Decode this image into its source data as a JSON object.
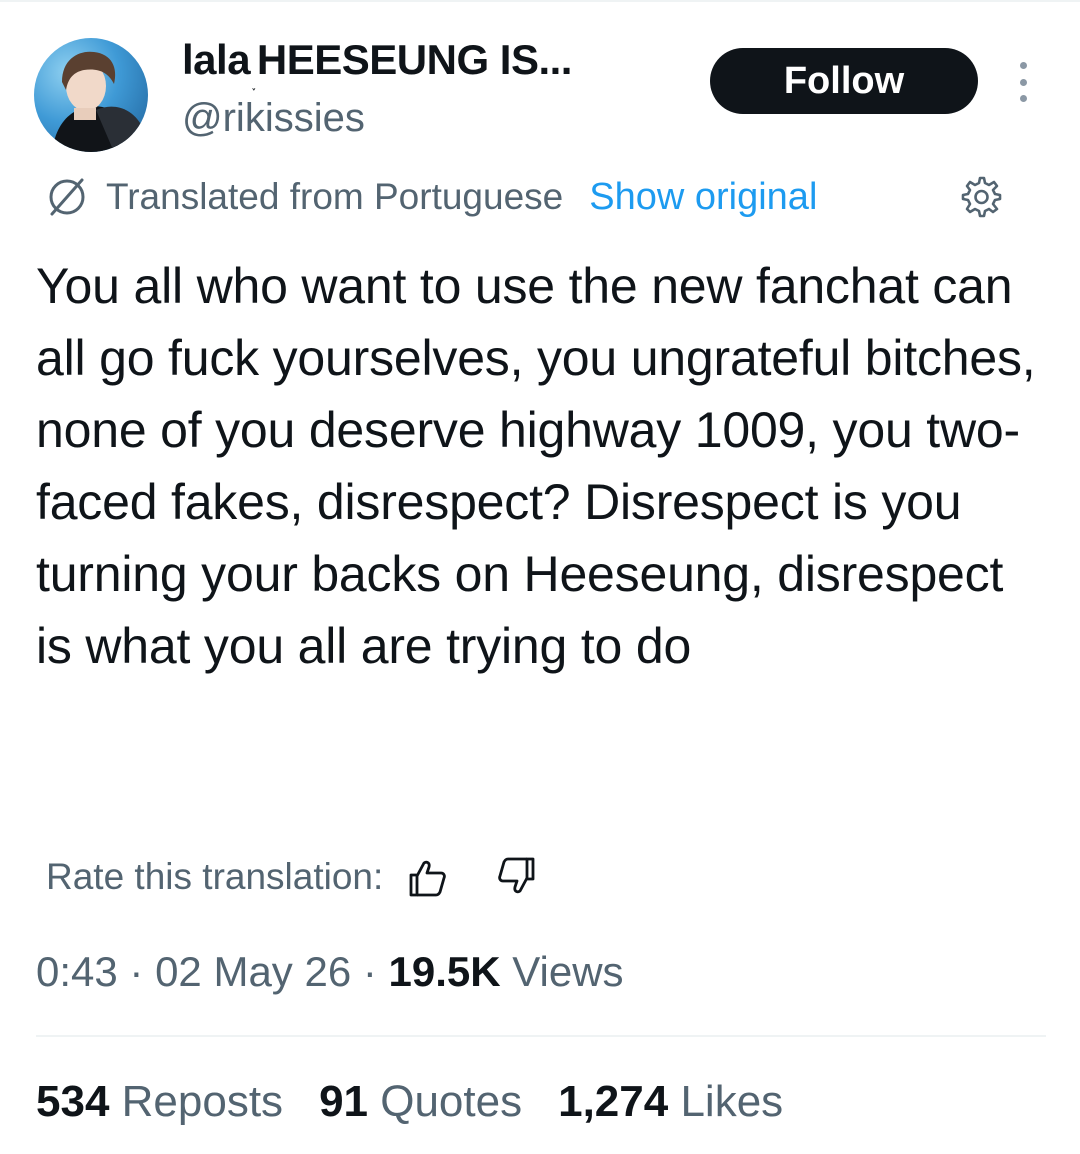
{
  "author": {
    "display_name": "lala",
    "display_name_deco": "˯",
    "display_name_rest": "HEESEUNG IS...",
    "handle": "@rikissies"
  },
  "follow_label": "Follow",
  "translation": {
    "label": "Translated from Portuguese",
    "show_original": "Show original",
    "rate_label": "Rate this translation:"
  },
  "tweet_text": "You all who want to use the new fanchat can all go fuck yourselves, you ungrateful bitches, none of you deserve highway 1009, you two-faced fakes, disrespect? Disrespect is you turning your backs on Heeseung, disrespect is what you all are trying to do",
  "meta": {
    "time": "0:43",
    "sep1": " · ",
    "date": "02 May 26",
    "sep2": " · ",
    "views_count": "19.5K",
    "views_label": " Views"
  },
  "stats": {
    "reposts_count": "534",
    "reposts_label": " Reposts",
    "quotes_count": "91",
    "quotes_label": " Quotes",
    "likes_count": "1,274",
    "likes_label": " Likes"
  },
  "icons": {
    "avatar": "profile-photo",
    "more": "more-vertical-icon",
    "translate": "globe-translate-icon",
    "settings": "gear-icon",
    "thumb_up": "thumb-up-icon",
    "thumb_down": "thumb-down-icon"
  },
  "colors": {
    "text_primary": "#0f1419",
    "text_secondary": "#536471",
    "link": "#1d9bf0",
    "button_bg": "#0f1419",
    "divider": "#eff3f4"
  }
}
